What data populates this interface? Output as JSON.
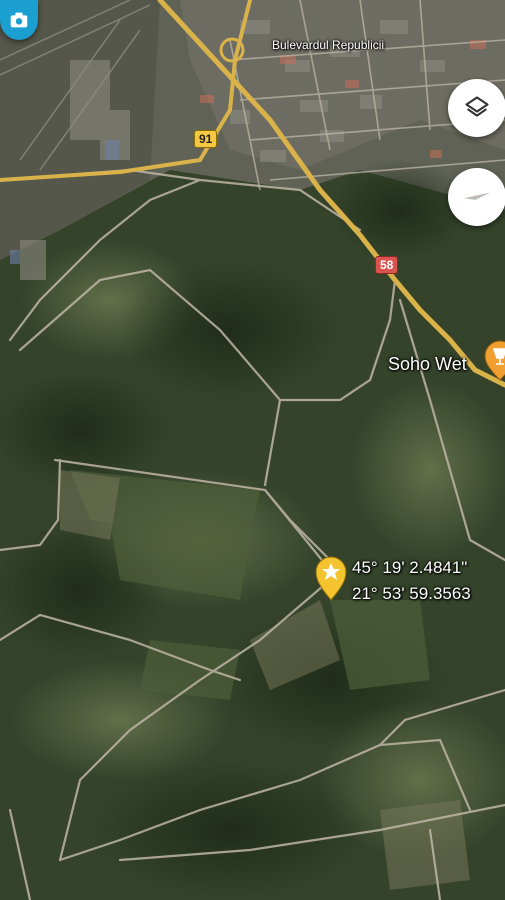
{
  "map": {
    "street_label": "Bulevardul Republicii",
    "poi_label": "Soho Wet",
    "route_shields": [
      "91",
      "58"
    ],
    "pin": {
      "latitude": "45° 19' 2.4841\"",
      "longitude": "21° 53' 59.3563"
    }
  },
  "controls": {
    "layers_icon": "layers-icon",
    "compass_icon": "compass-icon",
    "camera_icon": "camera-icon"
  },
  "colors": {
    "road_major": "#d9b24a",
    "road_minor": "#bfb7a6",
    "shield_91": "#f4c842",
    "shield_58": "#d9534f",
    "pin": "#f4c430",
    "poi_pin": "#f0a030",
    "compass_red": "#e53935"
  }
}
